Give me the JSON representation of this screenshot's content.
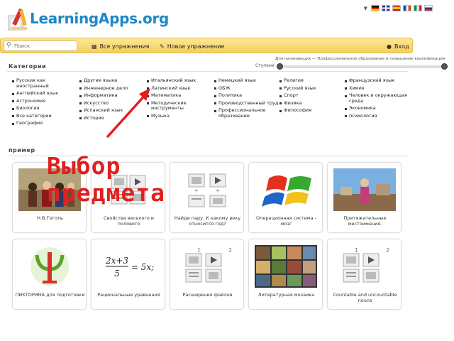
{
  "app": {
    "logo": "LearningApps.org"
  },
  "colors": {
    "accent": "#1e88c7",
    "bar": "#f6cf58",
    "overlay": "#e02020"
  },
  "search": {
    "placeholder": "Поиск"
  },
  "nav": {
    "all_exercises": "Все упражнения",
    "new_exercise": "Новое упражнение",
    "login": "Вход"
  },
  "target": {
    "label": "Для начинающих — Профессиональное образование и повышение квалификации",
    "level_label": "Ступени"
  },
  "categories": {
    "title": "Категории",
    "columns": [
      [
        "Русские как иностранный",
        "Английский язык",
        "Астрономия",
        "Биология",
        "Все категории",
        "География"
      ],
      [
        "Другие языки",
        "Инженерное дело",
        "Информатика",
        "Искусство",
        "Испанский язык",
        "История"
      ],
      [
        "Итальянский язык",
        "Латинский язык",
        "Математика",
        "Методические инструменты",
        "Музыка"
      ],
      [
        "Немецкий язык",
        "ОБЖ",
        "Политика",
        "Производственный труд",
        "Профессиональное образование"
      ],
      [
        "Религия",
        "Русский язык",
        "Спорт",
        "Физика",
        "Философия"
      ],
      [
        "Французский язык",
        "Химия",
        "Человек и окружающая среда",
        "Экономика",
        "психология"
      ]
    ]
  },
  "examples": {
    "title": "пример",
    "tiles": [
      {
        "label": "Н.В.Гоголь",
        "icon": "photo-thumbnail"
      },
      {
        "label": "Свойства веселого и полового",
        "icon": "exercise-icon"
      },
      {
        "label": "Найди пару. К какому веку относится год?",
        "icon": "exercise-icon"
      },
      {
        "label": "Операционная система - мозг",
        "icon": "windows-logo-thumbnail"
      },
      {
        "label": "Притяжательные местоимения.",
        "icon": "photo-thumbnail"
      },
      {
        "label": "ПИКТОРИНА для подготовки",
        "icon": "psi-logo-thumbnail"
      },
      {
        "label": "Рациональные уравнения",
        "icon": "equation-thumbnail"
      },
      {
        "label": "Расширения файлов",
        "icon": "exercise-icon"
      },
      {
        "label": "Литературная мозаика",
        "icon": "mosaic-thumbnail"
      },
      {
        "label": "Countable and uncountable nouns",
        "icon": "exercise-icon"
      }
    ]
  },
  "equation": {
    "text": "2x+3 / 5 = 5x;"
  },
  "overlay": {
    "line1": "Выбор",
    "line2": "предмета"
  }
}
